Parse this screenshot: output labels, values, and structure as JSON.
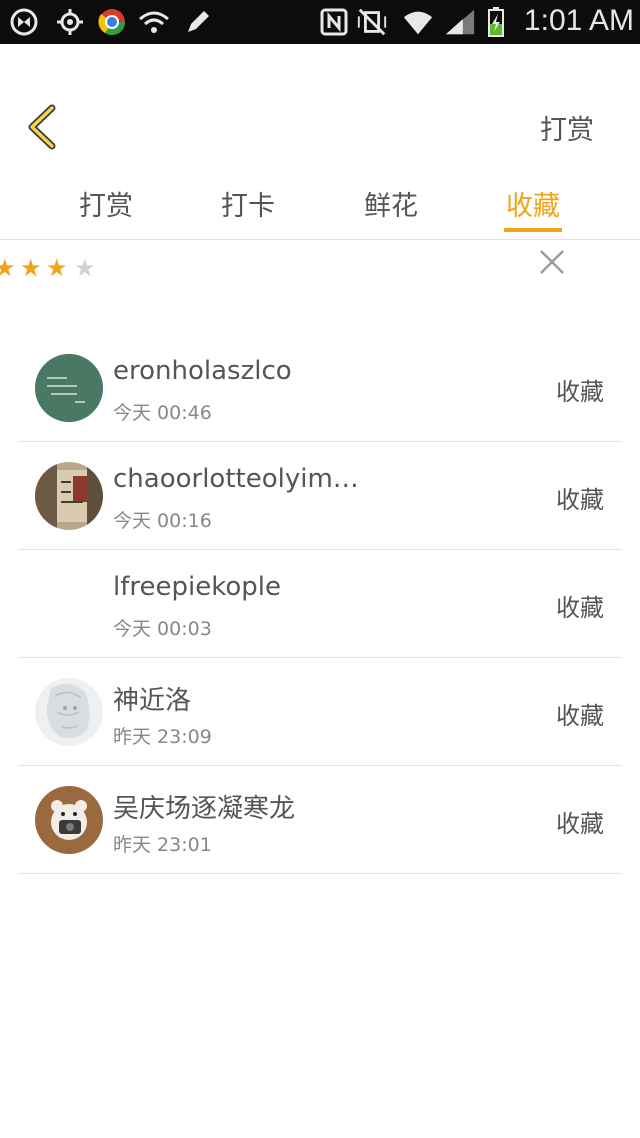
{
  "status_bar": {
    "time": "1:01 AM",
    "icons": [
      "sync-icon",
      "gps-icon",
      "chrome-icon",
      "wifi-question-icon",
      "pencil-icon",
      "nfc-icon",
      "mute-vibrate-icon",
      "wifi-icon",
      "signal-icon",
      "battery-charging-icon"
    ]
  },
  "header": {
    "back_icon": "chevron-left-icon",
    "action_label": "打赏"
  },
  "tabs": [
    {
      "label": "打赏",
      "active": false
    },
    {
      "label": "打卡",
      "active": false
    },
    {
      "label": "鲜花",
      "active": false
    },
    {
      "label": "收藏",
      "active": true
    }
  ],
  "rating": {
    "filled": 3,
    "total": 4,
    "accent_color": "#f0a418"
  },
  "list": [
    {
      "name": "eronholaszlco",
      "time": "今天 00:46",
      "action": "收藏",
      "avatar": "green-chalkboard-avatar"
    },
    {
      "name": "chaoorlotteolyimp…",
      "time": "今天 00:16",
      "action": "收藏",
      "avatar": "vintage-poster-avatar"
    },
    {
      "name": "lfreepiekople",
      "time": "今天 00:03",
      "action": "收藏",
      "avatar": ""
    },
    {
      "name": "神近洛",
      "time": "昨天 23:09",
      "action": "收藏",
      "avatar": "sketch-girl-avatar"
    },
    {
      "name": "吴庆场逐凝寒龙",
      "time": "昨天 23:01",
      "action": "收藏",
      "avatar": "bear-camera-avatar"
    }
  ]
}
